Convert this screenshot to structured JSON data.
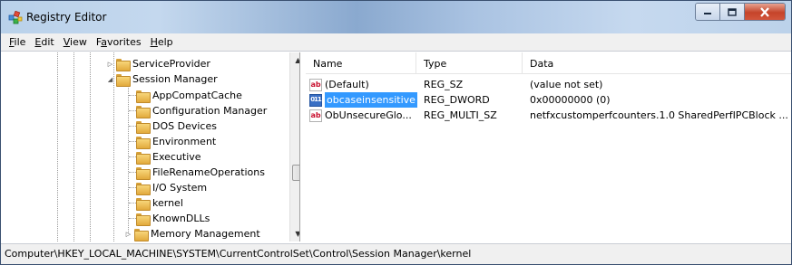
{
  "window": {
    "title": "Registry Editor",
    "app_icon": "registry-editor-icon"
  },
  "menu": [
    {
      "accel": "F",
      "rest": "ile"
    },
    {
      "accel": "E",
      "rest": "dit"
    },
    {
      "accel": "V",
      "rest": "iew"
    },
    {
      "pre": "F",
      "accel": "a",
      "rest": "vorites"
    },
    {
      "accel": "H",
      "rest": "elp"
    }
  ],
  "tree": {
    "items": [
      {
        "label": "ServiceProvider",
        "expander": "collapsed"
      },
      {
        "label": "Session Manager",
        "expander": "expanded"
      },
      {
        "label": "AppCompatCache"
      },
      {
        "label": "Configuration Manager"
      },
      {
        "label": "DOS Devices"
      },
      {
        "label": "Environment"
      },
      {
        "label": "Executive"
      },
      {
        "label": "FileRenameOperations"
      },
      {
        "label": "I/O System"
      },
      {
        "label": "kernel",
        "selected": true
      },
      {
        "label": "KnownDLLs"
      },
      {
        "label": "Memory Management",
        "expander": "collapsed"
      }
    ]
  },
  "values": {
    "headers": {
      "name": "Name",
      "type": "Type",
      "data": "Data"
    },
    "rows": [
      {
        "icon": "string-value-icon",
        "name": "(Default)",
        "type": "REG_SZ",
        "data": "(value not set)"
      },
      {
        "icon": "binary-value-icon",
        "name": "obcaseinsensitive",
        "type": "REG_DWORD",
        "data": "0x00000000 (0)",
        "selected": true
      },
      {
        "icon": "string-value-icon",
        "name": "ObUnsecureGlo...",
        "type": "REG_MULTI_SZ",
        "data": "netfxcustomperfcounters.1.0 SharedPerfIPCBlock ..."
      }
    ]
  },
  "status": {
    "path": "Computer\\HKEY_LOCAL_MACHINE\\SYSTEM\\CurrentControlSet\\Control\\Session Manager\\kernel"
  },
  "colors": {
    "selection": "#3399ff",
    "close_button": "#c5442a"
  }
}
